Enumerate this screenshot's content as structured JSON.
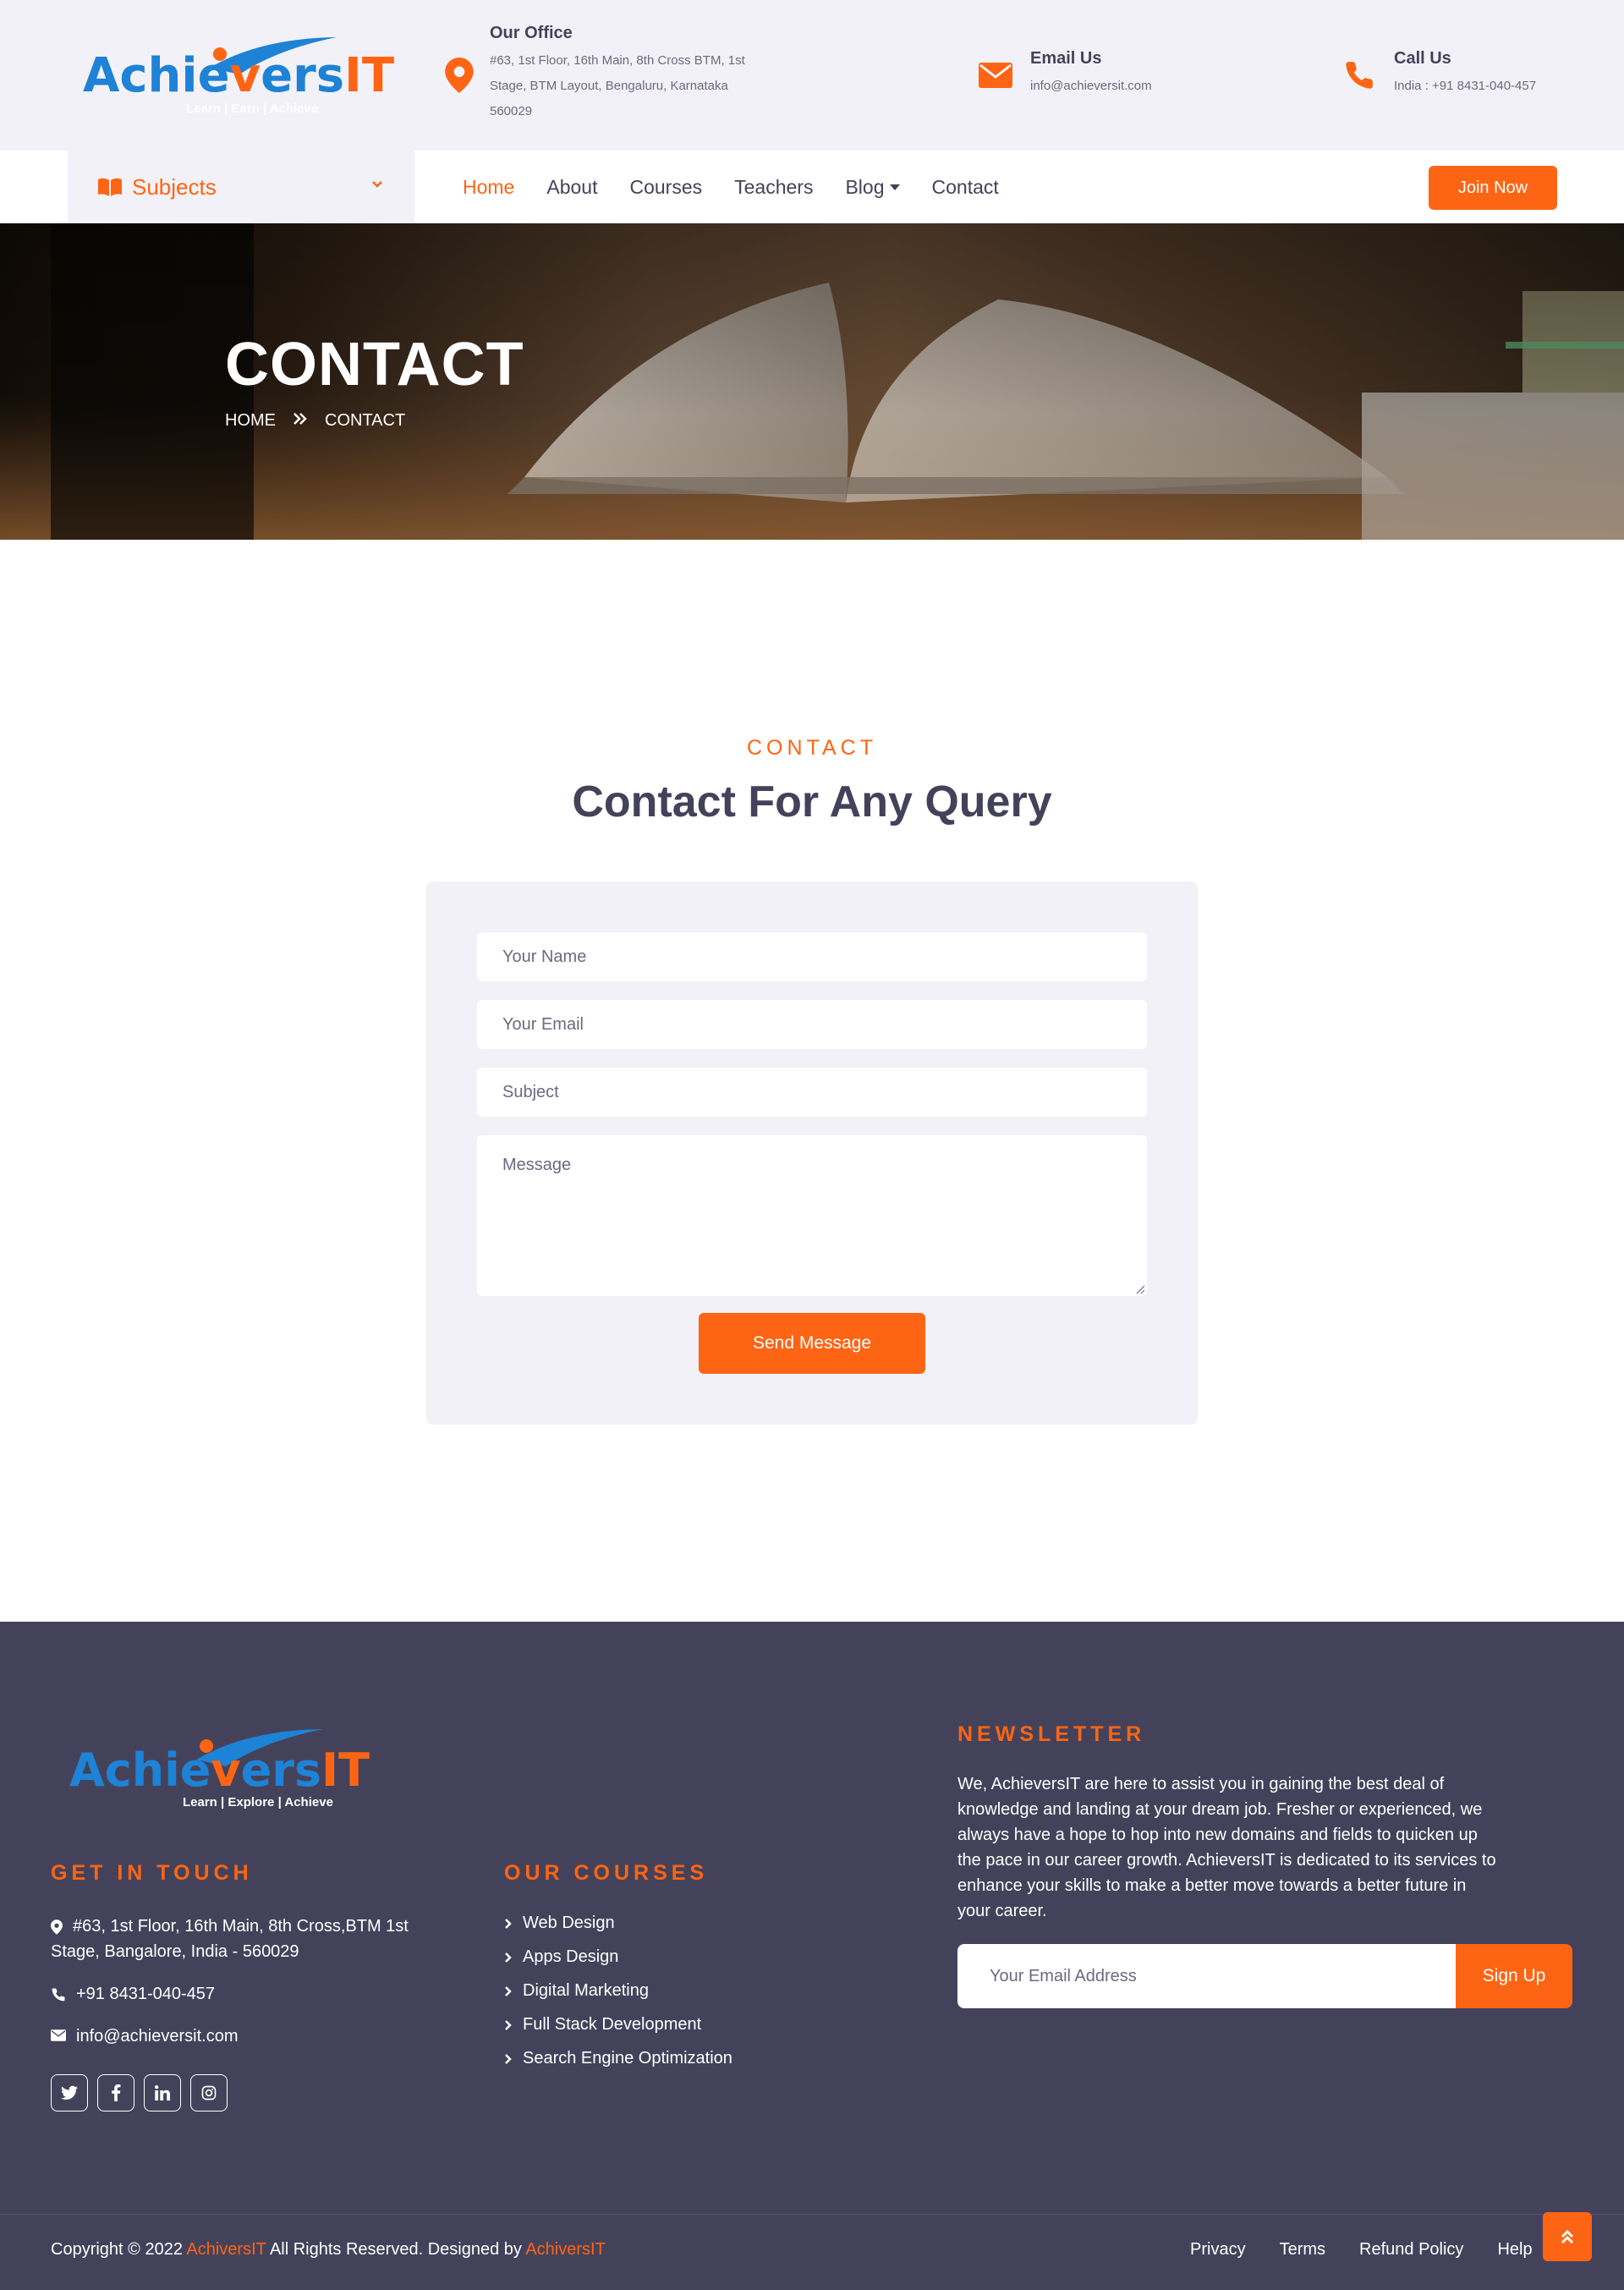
{
  "brand": {
    "logo_part1": "Achie",
    "logo_part2": "v",
    "logo_part3": "ers",
    "logo_part4": "IT",
    "header_tagline": "Learn | Earn | Achieve",
    "footer_tagline": "Learn | Explore | Achieve",
    "colors": {
      "accent": "#fd6514",
      "dark": "#44425a",
      "light": "#f2f1f7",
      "logo_blue": "#1e82d6"
    }
  },
  "topbar": {
    "office": {
      "title": "Our Office",
      "lines": [
        "#63, 1st Floor, 16th Main, 8th Cross BTM, 1st",
        "Stage, BTM Layout, Bengaluru, Karnataka",
        "560029"
      ],
      "icon": "map-marker-icon"
    },
    "email": {
      "title": "Email Us",
      "value": "info@achieversit.com",
      "icon": "envelope-icon"
    },
    "phone": {
      "title": "Call Us",
      "value": "India : +91 8431-040-457",
      "icon": "phone-icon"
    }
  },
  "nav": {
    "subjects_label": "Subjects",
    "links": [
      "Home",
      "About",
      "Courses",
      "Teachers",
      "Blog",
      "Contact"
    ],
    "active_index": 0,
    "join_label": "Join Now"
  },
  "hero": {
    "title": "CONTACT",
    "breadcrumb": [
      "HOME",
      "CONTACT"
    ]
  },
  "contact": {
    "subtitle": "CONTACT",
    "title": "Contact For Any Query",
    "fields": {
      "name": "Your Name",
      "email": "Your Email",
      "subject": "Subject",
      "message": "Message"
    },
    "send_label": "Send Message"
  },
  "footer": {
    "get_in_touch": {
      "heading": "GET IN TOUCH",
      "address_line1": "#63, 1st Floor, 16th Main, 8th Cross,BTM 1st",
      "address_line2": "Stage, Bangalore, India - 560029",
      "phone": "+91 8431-040-457",
      "email": "info@achieversit.com",
      "social": [
        "twitter-icon",
        "facebook-icon",
        "linkedin-icon",
        "instagram-icon"
      ]
    },
    "courses": {
      "heading": "OUR COURSES",
      "items": [
        "Web Design",
        "Apps Design",
        "Digital Marketing",
        "Full Stack Development",
        "Search Engine Optimization"
      ]
    },
    "newsletter": {
      "heading": "NEWSLETTER",
      "text_lines": [
        "We, AchieversIT are here to assist you in gaining the best deal of",
        "knowledge and landing at your dream job. Fresher or experienced, we",
        "always have a hope to hop into new domains and fields to quicken up",
        "the pace in our career growth. AchieversIT is dedicated to its services to",
        "enhance your skills to make a better move towards a better future in",
        "your career."
      ],
      "placeholder": "Your Email Address",
      "button": "Sign Up"
    },
    "bottom": {
      "copyright_prefix": "Copyright © 2022",
      "brand1": "AchiversIT",
      "middle": "All Rights Reserved. Designed by",
      "brand2": "AchiversIT",
      "links": [
        "Privacy",
        "Terms",
        "Refund Policy",
        "Help"
      ]
    }
  }
}
